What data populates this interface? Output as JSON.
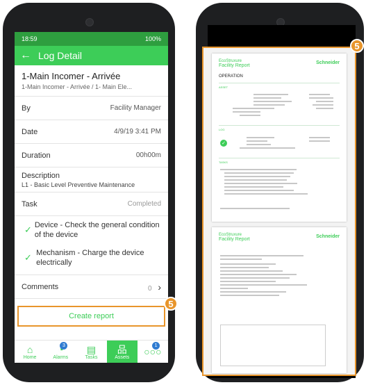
{
  "left_phone": {
    "status_bar": {
      "time": "18:59",
      "right": "100%"
    },
    "app_bar": {
      "back_icon": "arrow-left-icon",
      "title": "Log Detail"
    },
    "asset": {
      "title": "1-Main Incomer - Arrivée",
      "subtitle": "1-Main Incomer - Arrivée / 1- Main Ele..."
    },
    "rows": {
      "by": {
        "label": "By",
        "value": "Facility Manager"
      },
      "date": {
        "label": "Date",
        "value": "4/9/19 3:41 PM"
      },
      "duration": {
        "label": "Duration",
        "value": "00h00m"
      },
      "description": {
        "label": "Description",
        "value": "L1 - Basic Level Preventive Maintenance"
      },
      "task": {
        "label": "Task",
        "value": "Completed"
      },
      "comments": {
        "label": "Comments",
        "count": "0"
      }
    },
    "tasks": [
      {
        "text": "Device - Check the general condition of the device"
      },
      {
        "text": "Mechanism - Charge the device electrically"
      }
    ],
    "create_report": "Create report",
    "step_badge": "5",
    "tabs": [
      {
        "label": "Home",
        "icon": "home-icon"
      },
      {
        "label": "Alarms",
        "icon": "bell-icon",
        "badge": "3"
      },
      {
        "label": "Tasks",
        "icon": "tasks-icon"
      },
      {
        "label": "Assets",
        "icon": "assets-icon"
      },
      {
        "label": "",
        "icon": "more-icon",
        "badge": "1"
      }
    ]
  },
  "right_phone": {
    "step_badge": "5",
    "page1": {
      "brand": "EcoStruxure",
      "title": "Facility Report",
      "logo": "Schneider",
      "section": "OPERATION",
      "subsections": [
        "ASSET",
        "LOG",
        "TASKS"
      ]
    },
    "page2": {
      "brand": "EcoStruxure",
      "title": "Facility Report",
      "logo": "Schneider"
    }
  },
  "colors": {
    "accent_green": "#3dcd58",
    "status_green": "#2e9e3f",
    "highlight_orange": "#e8952b",
    "badge_blue": "#2f7bd1"
  }
}
